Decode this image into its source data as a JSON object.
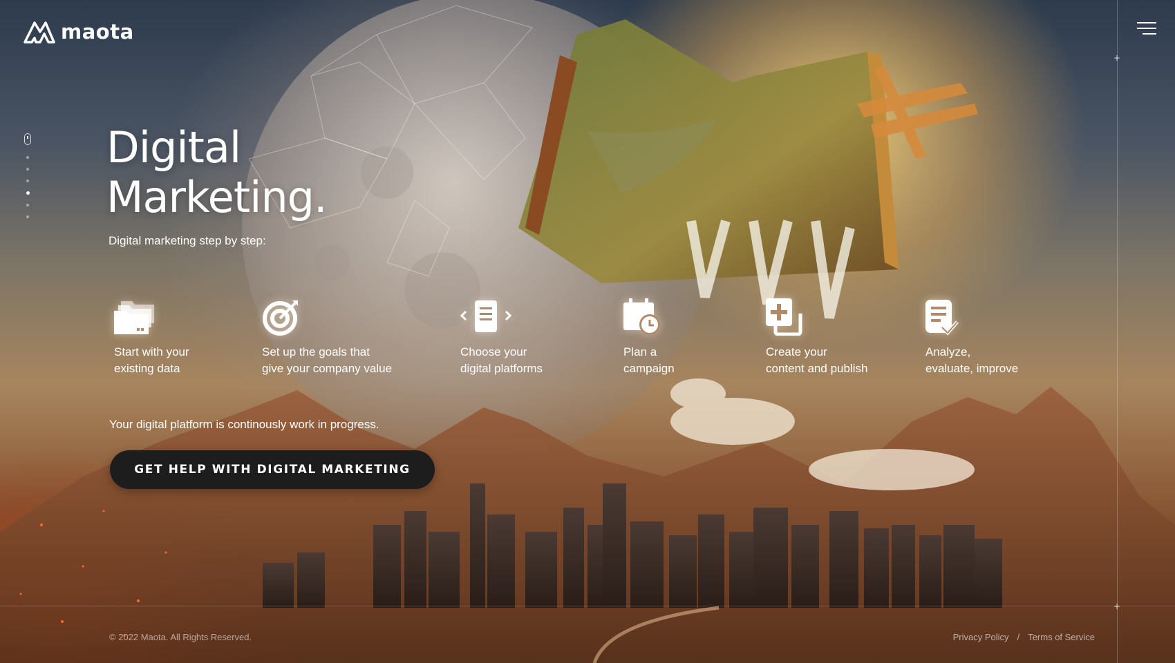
{
  "brand": {
    "name": "maota"
  },
  "hero": {
    "title_line1": "Digital",
    "title_line2": "Marketing.",
    "subtitle": "Digital marketing step by step:"
  },
  "side_nav": {
    "dot_count": 6,
    "active_index": 3
  },
  "steps": [
    {
      "icon": "folders-icon",
      "label": "Start with your\nexisting data"
    },
    {
      "icon": "target-icon",
      "label": "Set up the goals that\ngive your company value"
    },
    {
      "icon": "document-carousel-icon",
      "label": "Choose your\ndigital platforms"
    },
    {
      "icon": "calendar-clock-icon",
      "label": "Plan a\ncampaign"
    },
    {
      "icon": "add-content-icon",
      "label": "Create your\ncontent and publish"
    },
    {
      "icon": "checklist-icon",
      "label": "Analyze,\nevaluate, improve"
    }
  ],
  "progress_note": "Your digital platform is continously work in progress.",
  "cta": {
    "label": "GET HELP WITH DIGITAL MARKETING"
  },
  "footer": {
    "copyright": "© 2022 Maota. All Rights Reserved.",
    "privacy": "Privacy Policy",
    "separator": "/",
    "terms": "Terms of Service"
  },
  "colors": {
    "button_bg": "#1d1d1d",
    "text": "#ffffff"
  }
}
